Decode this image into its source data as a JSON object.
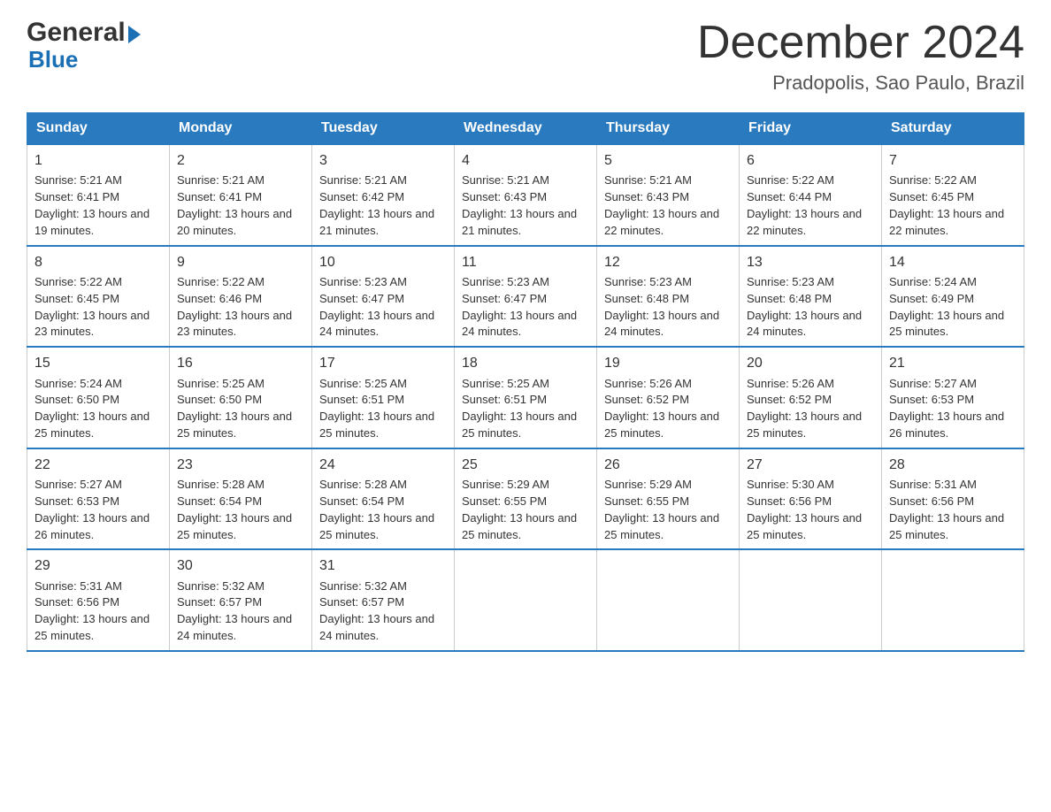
{
  "logo": {
    "general": "General",
    "blue": "Blue",
    "triangle": "▶"
  },
  "title": "December 2024",
  "subtitle": "Pradopolis, Sao Paulo, Brazil",
  "days_of_week": [
    "Sunday",
    "Monday",
    "Tuesday",
    "Wednesday",
    "Thursday",
    "Friday",
    "Saturday"
  ],
  "weeks": [
    [
      {
        "day": "1",
        "sunrise": "5:21 AM",
        "sunset": "6:41 PM",
        "daylight": "13 hours and 19 minutes."
      },
      {
        "day": "2",
        "sunrise": "5:21 AM",
        "sunset": "6:41 PM",
        "daylight": "13 hours and 20 minutes."
      },
      {
        "day": "3",
        "sunrise": "5:21 AM",
        "sunset": "6:42 PM",
        "daylight": "13 hours and 21 minutes."
      },
      {
        "day": "4",
        "sunrise": "5:21 AM",
        "sunset": "6:43 PM",
        "daylight": "13 hours and 21 minutes."
      },
      {
        "day": "5",
        "sunrise": "5:21 AM",
        "sunset": "6:43 PM",
        "daylight": "13 hours and 22 minutes."
      },
      {
        "day": "6",
        "sunrise": "5:22 AM",
        "sunset": "6:44 PM",
        "daylight": "13 hours and 22 minutes."
      },
      {
        "day": "7",
        "sunrise": "5:22 AM",
        "sunset": "6:45 PM",
        "daylight": "13 hours and 22 minutes."
      }
    ],
    [
      {
        "day": "8",
        "sunrise": "5:22 AM",
        "sunset": "6:45 PM",
        "daylight": "13 hours and 23 minutes."
      },
      {
        "day": "9",
        "sunrise": "5:22 AM",
        "sunset": "6:46 PM",
        "daylight": "13 hours and 23 minutes."
      },
      {
        "day": "10",
        "sunrise": "5:23 AM",
        "sunset": "6:47 PM",
        "daylight": "13 hours and 24 minutes."
      },
      {
        "day": "11",
        "sunrise": "5:23 AM",
        "sunset": "6:47 PM",
        "daylight": "13 hours and 24 minutes."
      },
      {
        "day": "12",
        "sunrise": "5:23 AM",
        "sunset": "6:48 PM",
        "daylight": "13 hours and 24 minutes."
      },
      {
        "day": "13",
        "sunrise": "5:23 AM",
        "sunset": "6:48 PM",
        "daylight": "13 hours and 24 minutes."
      },
      {
        "day": "14",
        "sunrise": "5:24 AM",
        "sunset": "6:49 PM",
        "daylight": "13 hours and 25 minutes."
      }
    ],
    [
      {
        "day": "15",
        "sunrise": "5:24 AM",
        "sunset": "6:50 PM",
        "daylight": "13 hours and 25 minutes."
      },
      {
        "day": "16",
        "sunrise": "5:25 AM",
        "sunset": "6:50 PM",
        "daylight": "13 hours and 25 minutes."
      },
      {
        "day": "17",
        "sunrise": "5:25 AM",
        "sunset": "6:51 PM",
        "daylight": "13 hours and 25 minutes."
      },
      {
        "day": "18",
        "sunrise": "5:25 AM",
        "sunset": "6:51 PM",
        "daylight": "13 hours and 25 minutes."
      },
      {
        "day": "19",
        "sunrise": "5:26 AM",
        "sunset": "6:52 PM",
        "daylight": "13 hours and 25 minutes."
      },
      {
        "day": "20",
        "sunrise": "5:26 AM",
        "sunset": "6:52 PM",
        "daylight": "13 hours and 25 minutes."
      },
      {
        "day": "21",
        "sunrise": "5:27 AM",
        "sunset": "6:53 PM",
        "daylight": "13 hours and 26 minutes."
      }
    ],
    [
      {
        "day": "22",
        "sunrise": "5:27 AM",
        "sunset": "6:53 PM",
        "daylight": "13 hours and 26 minutes."
      },
      {
        "day": "23",
        "sunrise": "5:28 AM",
        "sunset": "6:54 PM",
        "daylight": "13 hours and 25 minutes."
      },
      {
        "day": "24",
        "sunrise": "5:28 AM",
        "sunset": "6:54 PM",
        "daylight": "13 hours and 25 minutes."
      },
      {
        "day": "25",
        "sunrise": "5:29 AM",
        "sunset": "6:55 PM",
        "daylight": "13 hours and 25 minutes."
      },
      {
        "day": "26",
        "sunrise": "5:29 AM",
        "sunset": "6:55 PM",
        "daylight": "13 hours and 25 minutes."
      },
      {
        "day": "27",
        "sunrise": "5:30 AM",
        "sunset": "6:56 PM",
        "daylight": "13 hours and 25 minutes."
      },
      {
        "day": "28",
        "sunrise": "5:31 AM",
        "sunset": "6:56 PM",
        "daylight": "13 hours and 25 minutes."
      }
    ],
    [
      {
        "day": "29",
        "sunrise": "5:31 AM",
        "sunset": "6:56 PM",
        "daylight": "13 hours and 25 minutes."
      },
      {
        "day": "30",
        "sunrise": "5:32 AM",
        "sunset": "6:57 PM",
        "daylight": "13 hours and 24 minutes."
      },
      {
        "day": "31",
        "sunrise": "5:32 AM",
        "sunset": "6:57 PM",
        "daylight": "13 hours and 24 minutes."
      },
      null,
      null,
      null,
      null
    ]
  ]
}
